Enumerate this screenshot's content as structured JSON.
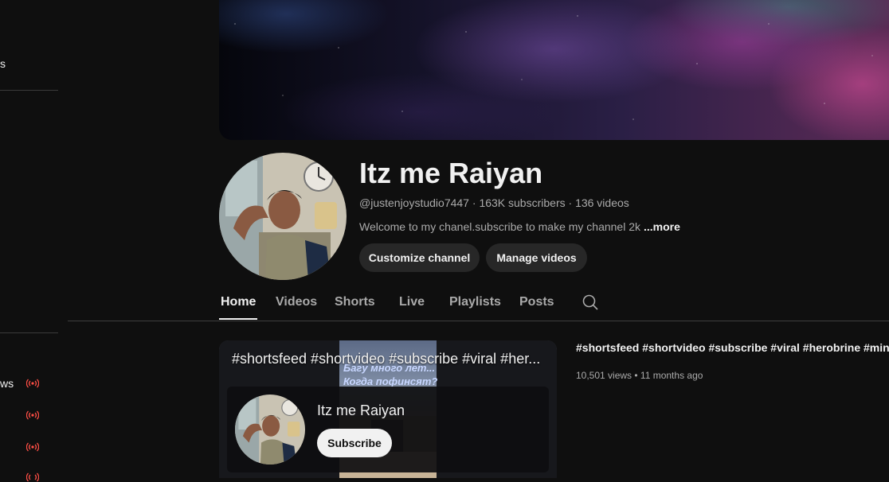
{
  "sidebar": {
    "partial_labels": [
      "s",
      "ws"
    ],
    "live_icon_count": 4,
    "live_color": "#ff4e45"
  },
  "channel": {
    "name": "Itz me Raiyan",
    "handle": "@justenjoystudio7447",
    "subscribers": "163K subscribers",
    "videos": "136 videos",
    "meta_separator": " · ",
    "description": "Welcome to my chanel.subscribe to make my channel 2k",
    "more_label": "...more",
    "customize_label": "Customize channel",
    "manage_label": "Manage videos"
  },
  "tabs": [
    {
      "label": "Home",
      "active": true
    },
    {
      "label": "Videos",
      "active": false
    },
    {
      "label": "Shorts",
      "active": false
    },
    {
      "label": "Live",
      "active": false
    },
    {
      "label": "Playlists",
      "active": false
    },
    {
      "label": "Posts",
      "active": false
    }
  ],
  "tab_search_icon": "search-icon",
  "featured": {
    "overlay_title": "#shortsfeed #shortvideo #subscribe #viral #her...",
    "video_caption_lines": [
      "Багу много лет...",
      "Когда пофинсят?"
    ],
    "overlay_channel_name": "Itz me Raiyan",
    "subscribe_label": "Subscribe",
    "title": "#shortsfeed #shortvideo #subscribe #viral #herobrine #minec...",
    "views": "10,501 views",
    "age": "11 months ago",
    "meta_separator": " • "
  }
}
